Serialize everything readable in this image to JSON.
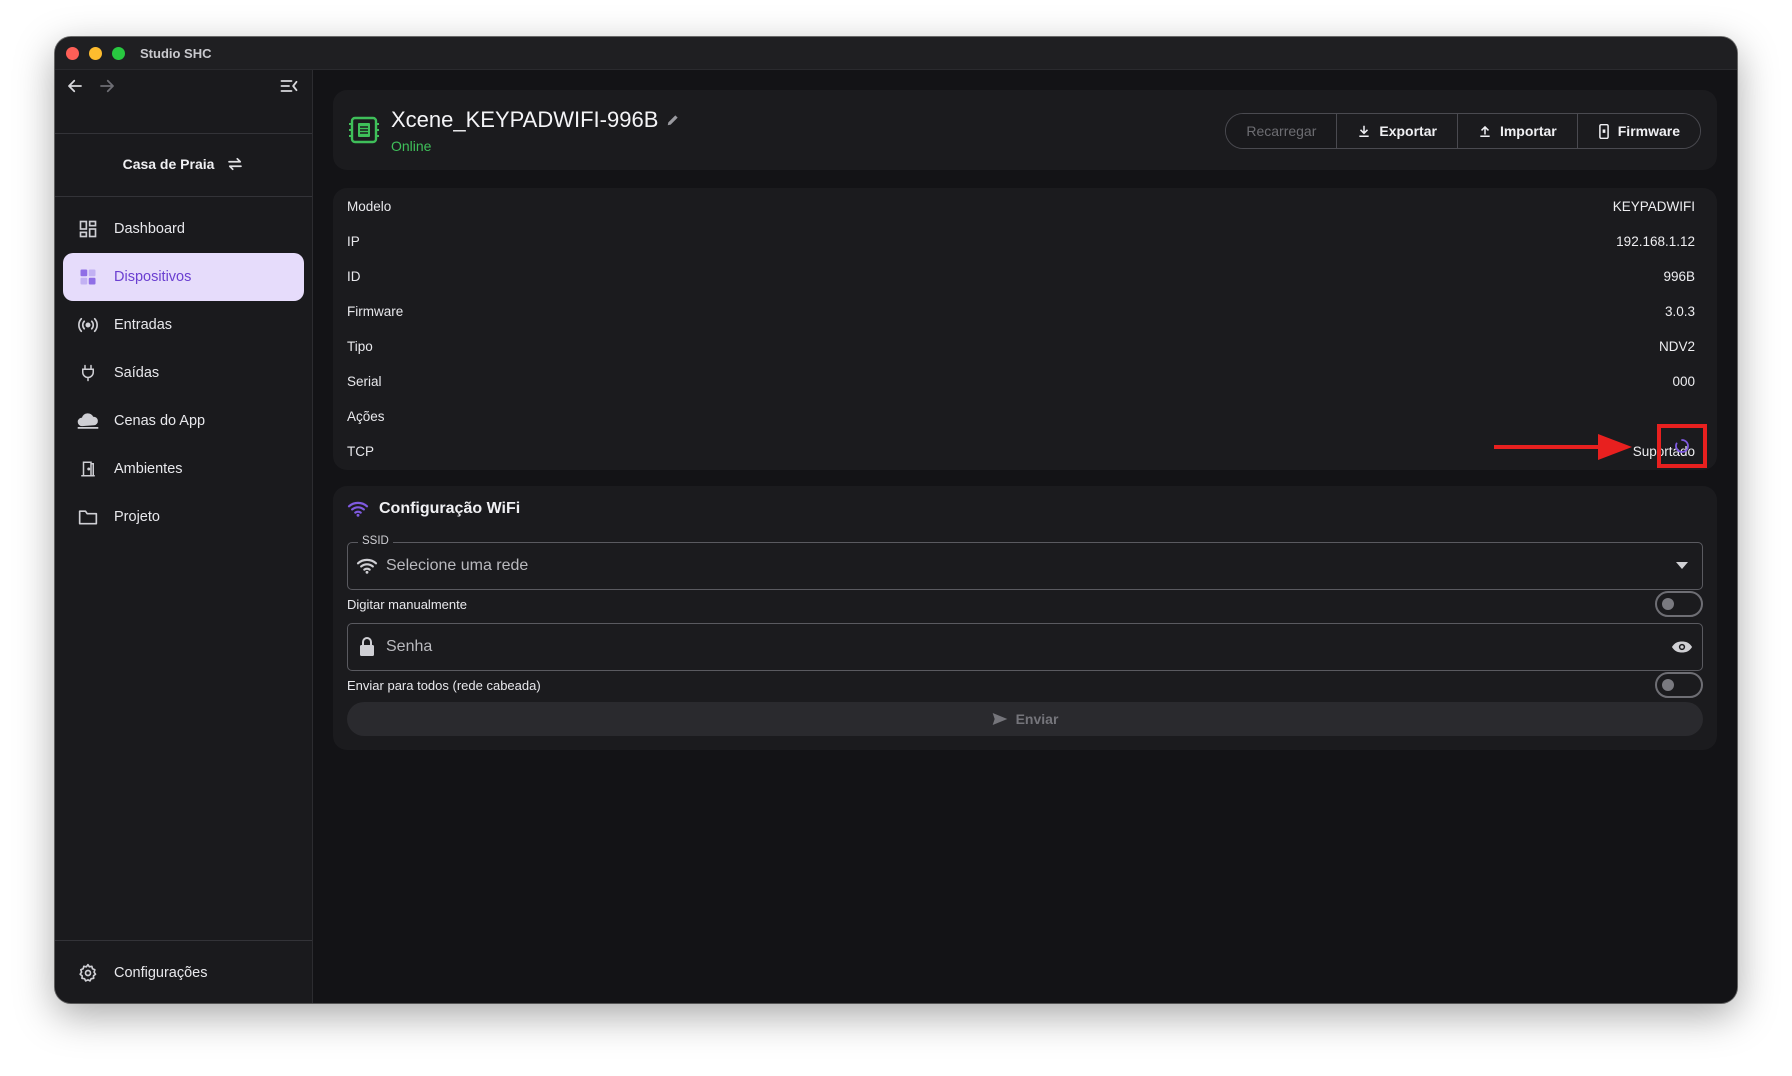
{
  "window": {
    "title": "Studio SHC"
  },
  "sidebar": {
    "project": "Casa de Praia",
    "items": [
      {
        "label": "Dashboard",
        "icon": "dashboard-icon",
        "active": false
      },
      {
        "label": "Dispositivos",
        "icon": "devices-icon",
        "active": true
      },
      {
        "label": "Entradas",
        "icon": "broadcast-icon",
        "active": false
      },
      {
        "label": "Saídas",
        "icon": "plug-icon",
        "active": false
      },
      {
        "label": "Cenas do App",
        "icon": "cloud-icon",
        "active": false
      },
      {
        "label": "Ambientes",
        "icon": "door-icon",
        "active": false
      },
      {
        "label": "Projeto",
        "icon": "folder-icon",
        "active": false
      }
    ],
    "settings": "Configurações"
  },
  "device": {
    "name": "Xcene_KEYPADWIFI-996B",
    "status": "Online",
    "actions": {
      "reload": "Recarregar",
      "export": "Exportar",
      "import": "Importar",
      "firmware": "Firmware"
    }
  },
  "info": {
    "rows": [
      {
        "label": "Modelo",
        "value": "KEYPADWIFI"
      },
      {
        "label": "IP",
        "value": "192.168.1.12"
      },
      {
        "label": "ID",
        "value": "996B"
      },
      {
        "label": "Firmware",
        "value": "3.0.3"
      },
      {
        "label": "Tipo",
        "value": "NDV2"
      },
      {
        "label": "Serial",
        "value": "000"
      },
      {
        "label": "Ações",
        "value": ""
      },
      {
        "label": "TCP",
        "value": "Suportado"
      }
    ]
  },
  "wifi": {
    "title": "Configuração WiFi",
    "ssid_label": "SSID",
    "ssid_placeholder": "Selecione uma rede",
    "manual_label": "Digitar manualmente",
    "manual_on": false,
    "password_placeholder": "Senha",
    "broadcast_label": "Enviar para todos (rede cabeada)",
    "broadcast_on": false,
    "send_label": "Enviar"
  },
  "colors": {
    "accent": "#7f5ae0",
    "online": "#3fbf5a",
    "annotation": "#e8201f"
  }
}
